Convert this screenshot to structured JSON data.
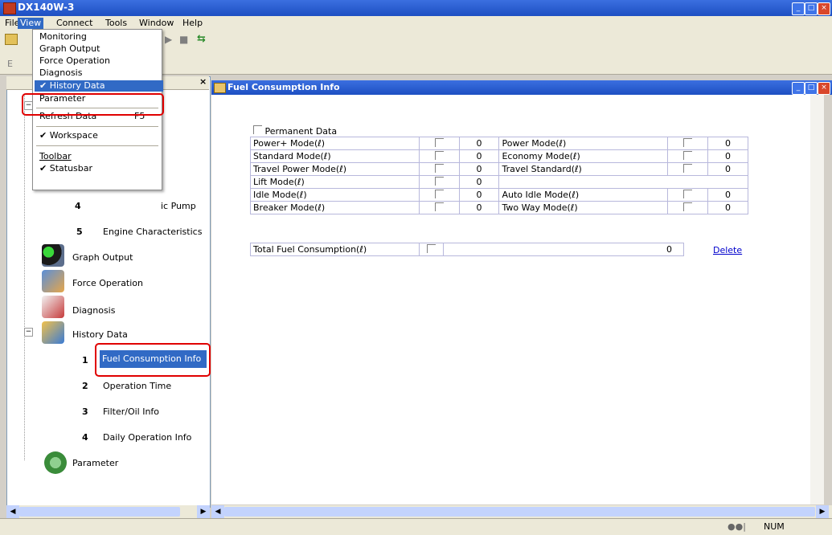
{
  "window": {
    "title": "DX140W-3"
  },
  "menubar": [
    "File",
    "View",
    "Connect",
    "Tools",
    "Window",
    "Help"
  ],
  "view_menu": {
    "items": [
      {
        "label": "Monitoring"
      },
      {
        "label": "Graph Output"
      },
      {
        "label": "Force Operation"
      },
      {
        "label": "Diagnosis"
      },
      {
        "label": "✔ History Data"
      },
      {
        "label": "Parameter"
      },
      {
        "label": "Refresh Data",
        "shortcut": "F5"
      },
      {
        "label": "✔ Workspace"
      },
      {
        "label": "Toolbar"
      },
      {
        "label": "✔ Statusbar"
      }
    ]
  },
  "tree": {
    "partial_label": "E",
    "items": [
      {
        "num": "4",
        "label": "Pump/Electronic Pump",
        "visible_label": "ic Pump"
      },
      {
        "num": "5",
        "label": "Engine Characteristics"
      },
      {
        "label": "Graph Output"
      },
      {
        "label": "Force Operation"
      },
      {
        "label": "Diagnosis"
      },
      {
        "label": "History Data"
      },
      {
        "num": "1",
        "label": "Fuel Consumption Info"
      },
      {
        "num": "2",
        "label": "Operation Time"
      },
      {
        "num": "3",
        "label": "Filter/Oil Info"
      },
      {
        "num": "4",
        "label": "Daily Operation Info"
      },
      {
        "label": "Parameter"
      }
    ]
  },
  "child_window": {
    "title": "Fuel Consumption Info"
  },
  "fuel": {
    "permanent_label": "Permanent Data",
    "rows": [
      {
        "l1": "Power+ Mode(ℓ)",
        "v1": "0",
        "l2": "Power Mode(ℓ)",
        "v2": "0"
      },
      {
        "l1": "Standard Mode(ℓ)",
        "v1": "0",
        "l2": "Economy Mode(ℓ)",
        "v2": "0"
      },
      {
        "l1": "Travel Power Mode(ℓ)",
        "v1": "0",
        "l2": "Travel Standard(ℓ)",
        "v2": "0"
      },
      {
        "l1": "Lift Mode(ℓ)",
        "v1": "0",
        "l2": "",
        "v2": ""
      },
      {
        "l1": "Idle Mode(ℓ)",
        "v1": "0",
        "l2": "Auto Idle Mode(ℓ)",
        "v2": "0"
      },
      {
        "l1": "Breaker Mode(ℓ)",
        "v1": "0",
        "l2": "Two Way Mode(ℓ)",
        "v2": "0"
      }
    ],
    "total_label": "Total Fuel Consumption(ℓ)",
    "total_value": "0",
    "delete_label": "Delete"
  },
  "statusbar": {
    "num": "NUM"
  },
  "colors": {
    "titlebar": "#1d4fc2",
    "highlight": "#316ac5",
    "callout": "#e00000"
  }
}
